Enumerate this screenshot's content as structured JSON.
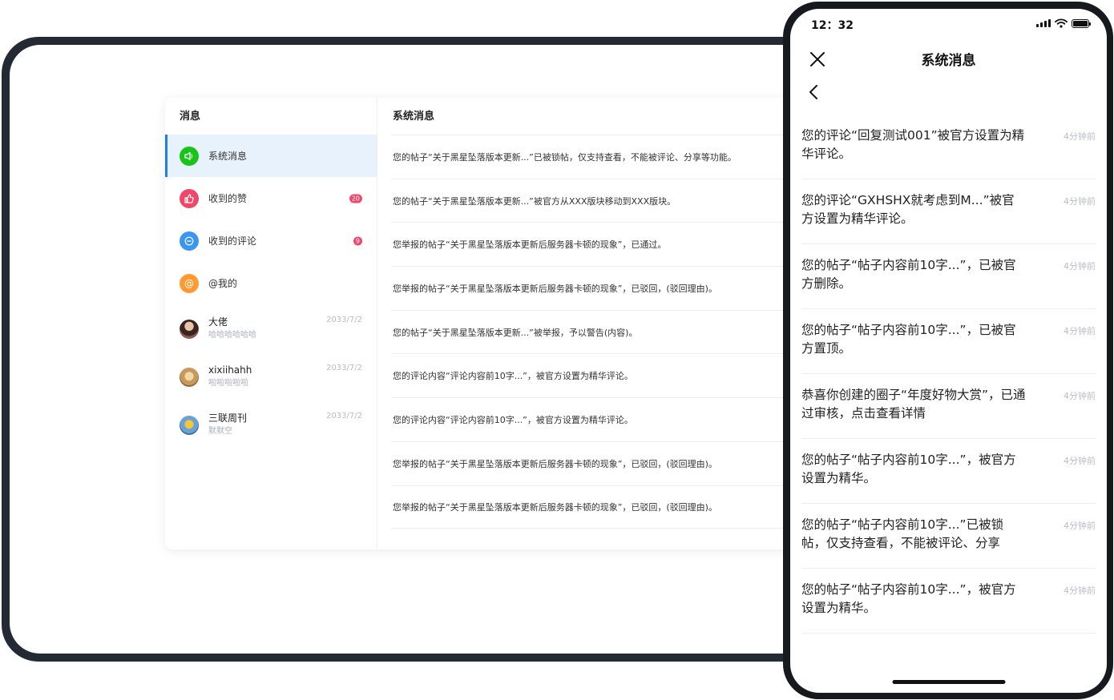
{
  "tablet": {
    "left_header": "消息",
    "right_header": "系统消息",
    "nav_items": [
      {
        "label": "系统消息",
        "badge": "",
        "icon": "speaker-icon",
        "color": "#19c319",
        "active": true
      },
      {
        "label": "收到的赞",
        "badge": "20",
        "icon": "thumbs-up-icon",
        "color": "#f0466a",
        "active": false
      },
      {
        "label": "收到的评论",
        "badge": "9",
        "icon": "comment-icon",
        "color": "#3b95f2",
        "active": false
      },
      {
        "label": "@我的",
        "badge": "",
        "icon": "at-icon",
        "color": "#ff9a33",
        "active": false
      }
    ],
    "contacts": [
      {
        "name": "大佬",
        "sub": "哈哈哈哈哈哈",
        "date": "2033/7/2"
      },
      {
        "name": "xixiihahh",
        "sub": "啦啦啦啦啦",
        "date": "2033/7/2"
      },
      {
        "name": "三联周刊",
        "sub": "默默空",
        "date": "2033/7/2"
      }
    ],
    "system_messages": [
      "您的帖子“关于黑星坠落版本更新...”已被锁帖，仅支持查看，不能被评论、分享等功能。",
      "您的帖子“关于黑星坠落版本更新...”被官方从XXX版块移动到XXX版块。",
      "您举报的帖子“关于黑星坠落版本更新后服务器卡顿的现象”，已通过。",
      "您举报的帖子“关于黑星坠落版本更新后服务器卡顿的现象”，已驳回，(驳回理由)。",
      "您的帖子“关于黑星坠落版本更新...”被举报，予以警告(内容)。",
      "您的评论内容“评论内容前10字...”，被官方设置为精华评论。",
      "您的评论内容“评论内容前10字...”，被官方设置为精华评论。",
      "您举报的帖子“关于黑星坠落版本更新后服务器卡顿的现象”，已驳回，(驳回理由)。",
      "您举报的帖子“关于黑星坠落版本更新后服务器卡顿的现象”，已驳回，(驳回理由)。"
    ]
  },
  "phone": {
    "status_time": "12：32",
    "title": "系统消息",
    "messages": [
      {
        "text": "您的评论“回复测试001”被官方设置为精华评论。",
        "time": "4分钟前"
      },
      {
        "text": "您的评论“GXHSHX就考虑到M...”被官方设置为精华评论。",
        "time": "4分钟前"
      },
      {
        "text": "您的帖子“帖子内容前10字...”，已被官方删除。",
        "time": "4分钟前"
      },
      {
        "text": "您的帖子“帖子内容前10字...”，已被官方置顶。",
        "time": "4分钟前"
      },
      {
        "text": "恭喜你创建的圈子“年度好物大赏”，已通过审核，点击查看详情",
        "time": "4分钟前"
      },
      {
        "text": "您的帖子“帖子内容前10字...”，被官方设置为精华。",
        "time": "4分钟前"
      },
      {
        "text": "您的帖子“帖子内容前10字...”已被锁帖，仅支持查看，不能被评论、分享",
        "time": "4分钟前"
      },
      {
        "text": "您的帖子“帖子内容前10字...”，被官方设置为精华。",
        "time": "4分钟前"
      }
    ]
  }
}
